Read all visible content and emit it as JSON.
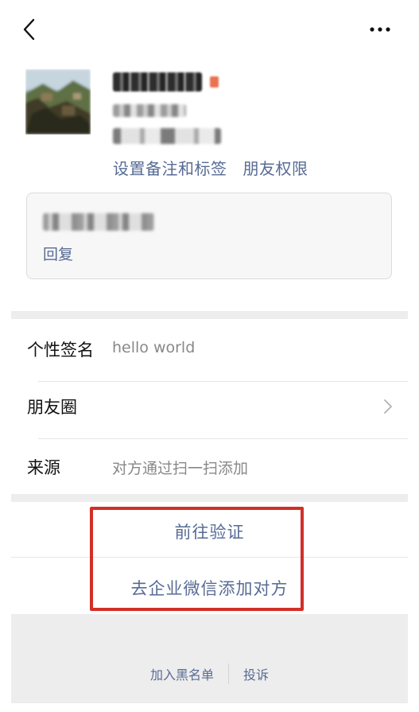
{
  "nav": {
    "back_icon": "chevron-left-icon",
    "more_icon": "more-dots-icon"
  },
  "profile": {
    "avatar_alt": "avatar",
    "links": [
      "设置备注和标签",
      "朋友权限"
    ]
  },
  "message": {
    "reply_label": "回复"
  },
  "info_rows": [
    {
      "label": "个性签名",
      "value": "hello world"
    },
    {
      "label": "朋友圈",
      "value": ""
    },
    {
      "label": "来源",
      "value": "对方通过扫一扫添加"
    }
  ],
  "actions": {
    "verify_label": "前往验证",
    "enterprise_label": "去企业微信添加对方",
    "highlight_color": "#d22f27"
  },
  "footer": {
    "blacklist_label": "加入黑名单",
    "report_label": "投诉"
  },
  "colors": {
    "link": "#576b95",
    "background_gray": "#ededed"
  }
}
